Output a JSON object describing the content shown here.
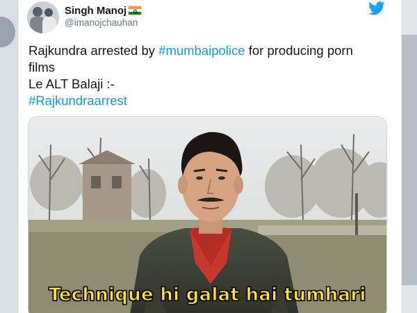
{
  "tweet": {
    "display_name": "Singh Manoj",
    "handle": "@imanojchauhan",
    "verified_flag": "india-flag-icon",
    "text_lines": [
      {
        "before": "Rajkundra arrested by ",
        "hashtag": "#mumbaipolice",
        "after": " for producing porn"
      },
      {
        "plain": "films"
      },
      {
        "plain": "Le ALT Balaji :-"
      },
      {
        "hashtag": "#Rajkundraarrest"
      }
    ]
  },
  "media": {
    "caption": "Technique hi galat hai tumhari"
  },
  "colors": {
    "twitter_blue": "#1da1f2",
    "hashtag": "#1b95e0",
    "caption_yellow": "#ffe23a"
  },
  "icons": [
    "twitter-bird-icon",
    "india-flag-icon"
  ]
}
